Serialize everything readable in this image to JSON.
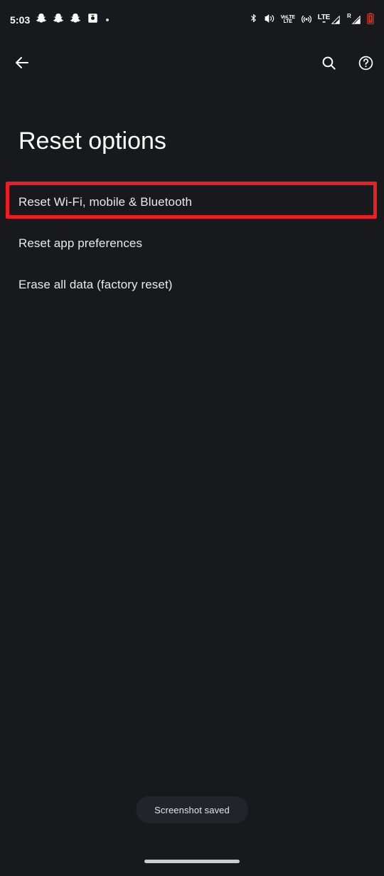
{
  "theme": {
    "background": "#17191C",
    "text_primary": "#FFFFFF",
    "text_secondary": "#E8EAED",
    "highlight_red": "#EE1C25",
    "toast_background": "#212429",
    "nav_pill": "#C9CCD0",
    "battery_red": "#D93025"
  },
  "status_bar": {
    "clock": "5:03",
    "left_icons": [
      {
        "name": "snapchat-icon",
        "label": "Snapchat notification"
      },
      {
        "name": "snapchat-icon",
        "label": "Snapchat notification"
      },
      {
        "name": "snapchat-icon",
        "label": "Snapchat notification"
      },
      {
        "name": "screenshot-icon",
        "label": "Screenshot capture"
      },
      {
        "name": "more-notifications-dot",
        "label": "More notifications"
      }
    ],
    "right_icons": [
      {
        "name": "bluetooth-icon",
        "label": "Bluetooth on"
      },
      {
        "name": "vibrate-icon",
        "label": "Ringer set to vibrate"
      },
      {
        "name": "volte-icon",
        "label": "VoLTE",
        "text_top": "VoLTE",
        "text_bottom": "LTE"
      },
      {
        "name": "hotspot-icon",
        "label": "Mobile hotspot"
      },
      {
        "name": "lte-signal-icon",
        "label": "LTE signal SIM 1",
        "text_top": "LTE",
        "text_bottom": "▪▪"
      },
      {
        "name": "roaming-signal-icon",
        "label": "Roaming signal SIM 2",
        "text": "R"
      },
      {
        "name": "battery-low-icon",
        "label": "Battery low"
      }
    ]
  },
  "toolbar": {
    "back_label": "Navigate up",
    "back_icon": "arrow-back-icon",
    "search_label": "Search settings",
    "search_icon": "search-icon",
    "help_label": "Help & feedback",
    "help_icon": "help-circle-icon"
  },
  "page": {
    "title": "Reset options"
  },
  "list": {
    "items": [
      {
        "label": "Reset Wi-Fi, mobile & Bluetooth",
        "highlighted": true
      },
      {
        "label": "Reset app preferences",
        "highlighted": false
      },
      {
        "label": "Erase all data (factory reset)",
        "highlighted": false
      }
    ]
  },
  "toast": {
    "message": "Screenshot saved"
  },
  "navigation": {
    "pill_label": "Home gesture bar"
  }
}
